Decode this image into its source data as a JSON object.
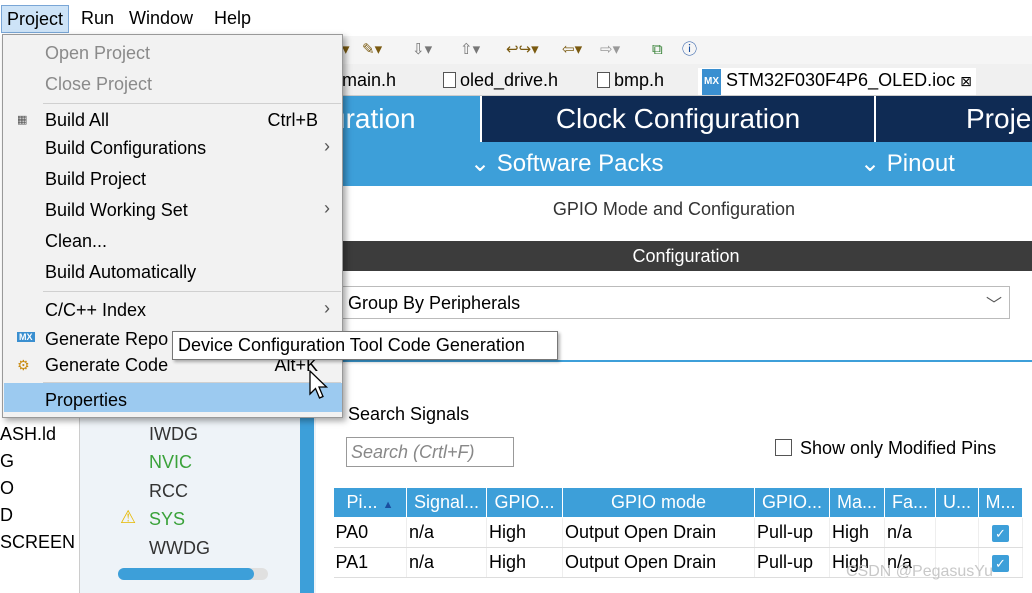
{
  "menubar": {
    "items": [
      "Project",
      "Run",
      "Window",
      "Help"
    ]
  },
  "tabs": [
    "main.h",
    "oled_drive.h",
    "bmp.h",
    "STM32F030F4P6_OLED.ioc"
  ],
  "tab_close": "⊠",
  "header": {
    "pinout_tab": "uration",
    "clock_tab": "Clock Configuration",
    "project_tab": "Proje",
    "software_packs": "Software Packs",
    "pinout": "Pinout"
  },
  "panel": {
    "title": "GPIO Mode and Configuration",
    "config_bar": "Configuration",
    "group_by": "Group By Peripherals",
    "search_label": "Search Signals",
    "search_placeholder": "Search (Crtl+F)",
    "show_modified": "Show only Modified Pins"
  },
  "far_left_items": [
    "ASH.ld",
    "G",
    "O",
    "D",
    "SCREEN"
  ],
  "peripherals": [
    {
      "name": "IWDG",
      "color": "#333333"
    },
    {
      "name": "NVIC",
      "color": "#3aa23a"
    },
    {
      "name": "RCC",
      "color": "#333333"
    },
    {
      "name": "SYS",
      "color": "#3aa23a",
      "warning": true
    },
    {
      "name": "WWDG",
      "color": "#333333"
    }
  ],
  "table": {
    "headers": [
      "Pi...",
      "Signal...",
      "GPIO...",
      "GPIO mode",
      "GPIO...",
      "Ma...",
      "Fa...",
      "U...",
      "M..."
    ],
    "rows": [
      [
        "PA0",
        "n/a",
        "High",
        "Output Open Drain",
        "Pull-up",
        "High",
        "n/a",
        "",
        "✓"
      ],
      [
        "PA1",
        "n/a",
        "High",
        "Output Open Drain",
        "Pull-up",
        "High",
        "n/a",
        "",
        "✓"
      ]
    ]
  },
  "menu": {
    "open_project": "Open Project",
    "close_project": "Close Project",
    "build_all": "Build All",
    "build_all_shortcut": "Ctrl+B",
    "build_configurations": "Build Configurations",
    "build_project": "Build Project",
    "build_working_set": "Build Working Set",
    "clean": "Clean...",
    "build_automatically": "Build Automatically",
    "cpp_index": "C/C++ Index",
    "generate_report": "Generate Repo",
    "generate_code": "Generate Code",
    "generate_code_shortcut": "Alt+K",
    "properties": "Properties"
  },
  "tooltip": "Device Configuration Tool Code Generation",
  "watermark": "CSDN @PegasusYu",
  "colors": {
    "accent_blue": "#3d9fd9",
    "dark_navy": "#0f2b54",
    "highlight": "#9ccaf0"
  }
}
